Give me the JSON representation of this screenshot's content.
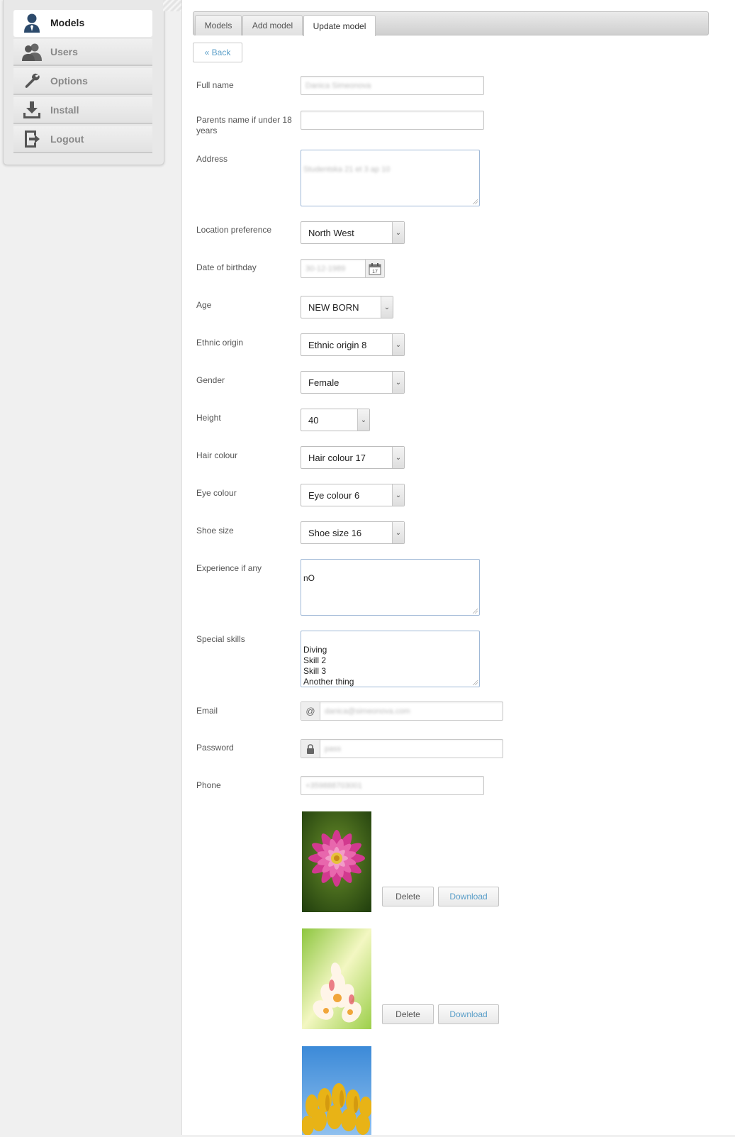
{
  "sidebar": {
    "items": [
      {
        "label": "Models",
        "icon": "user-icon",
        "active": true
      },
      {
        "label": "Users",
        "icon": "users-icon",
        "active": false
      },
      {
        "label": "Options",
        "icon": "wrench-icon",
        "active": false
      },
      {
        "label": "Install",
        "icon": "download-icon",
        "active": false
      },
      {
        "label": "Logout",
        "icon": "logout-icon",
        "active": false
      }
    ]
  },
  "tabs": [
    {
      "label": "Models"
    },
    {
      "label": "Add model"
    },
    {
      "label": "Update model",
      "active": true
    }
  ],
  "back_label": "« Back",
  "form": {
    "full_name": {
      "label": "Full name",
      "value": "Danica Simeonova"
    },
    "parents_name": {
      "label": "Parents name if under 18 years",
      "value": ""
    },
    "address": {
      "label": "Address",
      "value": "Studentska 21 et 3 ap 10"
    },
    "location": {
      "label": "Location preference",
      "value": "North West"
    },
    "birthday": {
      "label": "Date of birthday",
      "value": "30-12-1989",
      "calendar_day": "17"
    },
    "age": {
      "label": "Age",
      "value": "NEW BORN"
    },
    "ethnic": {
      "label": "Ethnic origin",
      "value": "Ethnic origin 8"
    },
    "gender": {
      "label": "Gender",
      "value": "Female"
    },
    "height": {
      "label": "Height",
      "value": "40"
    },
    "hair": {
      "label": "Hair colour",
      "value": "Hair colour 17"
    },
    "eye": {
      "label": "Eye colour",
      "value": "Eye colour 6"
    },
    "shoe": {
      "label": "Shoe size",
      "value": "Shoe size 16"
    },
    "experience": {
      "label": "Experience if any",
      "value": "nO"
    },
    "skills": {
      "label": "Special skills",
      "value": "Diving\nSkill 2\nSkill 3\nAnother thing"
    },
    "email": {
      "label": "Email",
      "value": "danica@simeonova.com",
      "addon": "@"
    },
    "password": {
      "label": "Password",
      "value": "pass"
    },
    "phone": {
      "label": "Phone",
      "value": "+359888703001"
    }
  },
  "photos": {
    "delete_label": "Delete",
    "download_label": "Download"
  }
}
